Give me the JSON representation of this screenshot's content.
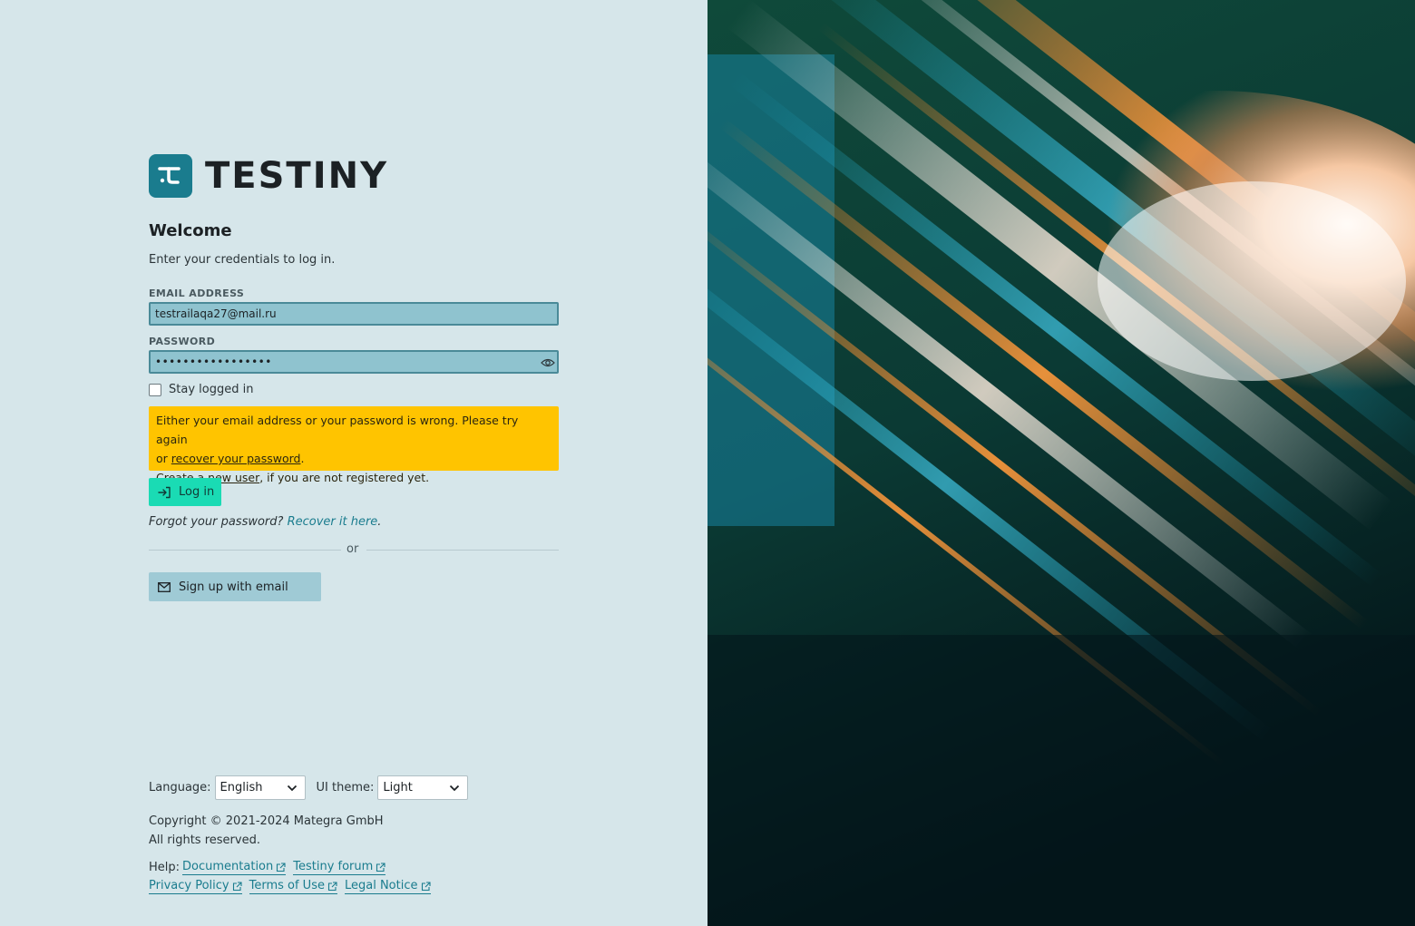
{
  "brand": {
    "name": "TESTINY"
  },
  "login": {
    "title": "Welcome",
    "subtitle": "Enter your credentials to log in.",
    "email_label": "EMAIL ADDRESS",
    "email_value": "testrailaqa27@mail.ru",
    "password_label": "PASSWORD",
    "password_value": "•••••••••••••••••",
    "stay_logged_in": "Stay logged in",
    "stay_logged_in_checked": false,
    "error": {
      "line1": "Either your email address or your password is wrong. Please try again",
      "or": "or ",
      "recover_link": "recover your password",
      "period": ".",
      "create_link": "Create a new user",
      "create_suffix": ", if you are not registered yet."
    },
    "login_button": "Log in",
    "forgot_text": "Forgot your password? ",
    "recover_here": "Recover it here",
    "forgot_period": ".",
    "divider": "or",
    "signup_button": "Sign up with email"
  },
  "settings": {
    "language_label": "Language:",
    "language_value": "English",
    "theme_label": "UI theme:",
    "theme_value": "Light"
  },
  "footer": {
    "copyright": "Copyright © 2021-2024 Mategra GmbH",
    "rights": "All rights reserved.",
    "help_label": "Help:",
    "documentation": "Documentation",
    "forum": "Testiny forum",
    "privacy": "Privacy Policy",
    "terms": "Terms of Use",
    "legal": "Legal Notice"
  },
  "colors": {
    "panel_bg": "#d6e6ea",
    "brand_teal": "#1a7c8e",
    "alert_yellow": "#ffc400",
    "login_green": "#1adbb4",
    "input_fill": "#8fc3cf"
  },
  "icons": [
    "testiny-logo-icon",
    "eye-icon",
    "login-icon",
    "mail-icon",
    "chevron-down-icon",
    "external-link-icon"
  ]
}
